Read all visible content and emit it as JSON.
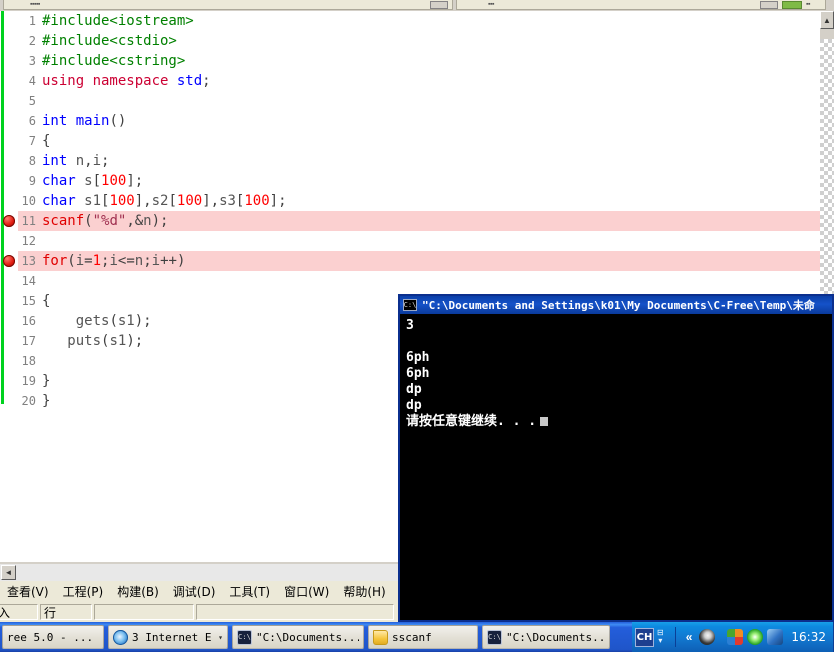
{
  "ide": {
    "menu": [
      {
        "label": "查看(V)"
      },
      {
        "label": "工程(P)"
      },
      {
        "label": "构建(B)"
      },
      {
        "label": "调试(D)"
      },
      {
        "label": "工具(T)"
      },
      {
        "label": "窗口(W)"
      },
      {
        "label": "帮助(H)"
      }
    ],
    "status": {
      "insert_mode": "插入",
      "line_label": "行",
      "cell3": "",
      "cell4": ""
    },
    "scroll": {
      "left_arrow": "◄",
      "up_arrow": "▲"
    }
  },
  "code": {
    "breakpoint_lines": [
      11,
      13
    ],
    "highlighted_lines": [
      11,
      13
    ],
    "lines": [
      {
        "n": "1",
        "tokens": [
          {
            "t": "#include<iostream>",
            "c": "pp"
          }
        ]
      },
      {
        "n": "2",
        "tokens": [
          {
            "t": "#include<cstdio>",
            "c": "pp"
          }
        ]
      },
      {
        "n": "3",
        "tokens": [
          {
            "t": "#include<cstring>",
            "c": "pp"
          }
        ]
      },
      {
        "n": "4",
        "tokens": [
          {
            "t": "using namespace ",
            "c": "kr"
          },
          {
            "t": "std",
            "c": "k"
          },
          {
            "t": ";",
            "c": "pn"
          }
        ]
      },
      {
        "n": "5",
        "tokens": []
      },
      {
        "n": "6",
        "tokens": [
          {
            "t": "int",
            "c": "k"
          },
          {
            "t": " ",
            "c": "pn"
          },
          {
            "t": "main",
            "c": "k"
          },
          {
            "t": "()",
            "c": "pn"
          }
        ]
      },
      {
        "n": "7",
        "tokens": [
          {
            "t": "{",
            "c": "pn"
          }
        ]
      },
      {
        "n": "8",
        "tokens": [
          {
            "t": "int",
            "c": "k"
          },
          {
            "t": " ",
            "c": "pn"
          },
          {
            "t": "n",
            "c": "id"
          },
          {
            "t": ",",
            "c": "pn"
          },
          {
            "t": "i",
            "c": "id"
          },
          {
            "t": ";",
            "c": "pn"
          }
        ]
      },
      {
        "n": "9",
        "tokens": [
          {
            "t": "char",
            "c": "k"
          },
          {
            "t": " ",
            "c": "pn"
          },
          {
            "t": "s",
            "c": "id"
          },
          {
            "t": "[",
            "c": "pn"
          },
          {
            "t": "100",
            "c": "num"
          },
          {
            "t": "];",
            "c": "pn"
          }
        ]
      },
      {
        "n": "10",
        "tokens": [
          {
            "t": "char",
            "c": "k"
          },
          {
            "t": " ",
            "c": "pn"
          },
          {
            "t": "s1",
            "c": "id"
          },
          {
            "t": "[",
            "c": "pn"
          },
          {
            "t": "100",
            "c": "num"
          },
          {
            "t": "],",
            "c": "pn"
          },
          {
            "t": "s2",
            "c": "id"
          },
          {
            "t": "[",
            "c": "pn"
          },
          {
            "t": "100",
            "c": "num"
          },
          {
            "t": "],",
            "c": "pn"
          },
          {
            "t": "s3",
            "c": "id"
          },
          {
            "t": "[",
            "c": "pn"
          },
          {
            "t": "100",
            "c": "num"
          },
          {
            "t": "];",
            "c": "pn"
          }
        ]
      },
      {
        "n": "11",
        "tokens": [
          {
            "t": "scanf",
            "c": "fn"
          },
          {
            "t": "(",
            "c": "pn"
          },
          {
            "t": "\"%d\"",
            "c": "str"
          },
          {
            "t": ",&",
            "c": "pn"
          },
          {
            "t": "n",
            "c": "id"
          },
          {
            "t": ");",
            "c": "pn"
          }
        ]
      },
      {
        "n": "12",
        "tokens": []
      },
      {
        "n": "13",
        "tokens": [
          {
            "t": "for",
            "c": "fn"
          },
          {
            "t": "(",
            "c": "pn"
          },
          {
            "t": "i",
            "c": "id"
          },
          {
            "t": "=",
            "c": "pn"
          },
          {
            "t": "1",
            "c": "num"
          },
          {
            "t": ";",
            "c": "pn"
          },
          {
            "t": "i",
            "c": "id"
          },
          {
            "t": "<=",
            "c": "pn"
          },
          {
            "t": "n",
            "c": "id"
          },
          {
            "t": ";",
            "c": "pn"
          },
          {
            "t": "i",
            "c": "id"
          },
          {
            "t": "++)",
            "c": "pn"
          }
        ]
      },
      {
        "n": "14",
        "tokens": []
      },
      {
        "n": "15",
        "tokens": [
          {
            "t": "{",
            "c": "pn"
          }
        ]
      },
      {
        "n": "16",
        "tokens": [
          {
            "t": "    gets",
            "c": "id"
          },
          {
            "t": "(",
            "c": "pn"
          },
          {
            "t": "s1",
            "c": "id"
          },
          {
            "t": ");",
            "c": "pn"
          }
        ]
      },
      {
        "n": "17",
        "tokens": [
          {
            "t": "   puts",
            "c": "id"
          },
          {
            "t": "(",
            "c": "pn"
          },
          {
            "t": "s1",
            "c": "id"
          },
          {
            "t": ");",
            "c": "pn"
          }
        ]
      },
      {
        "n": "18",
        "tokens": []
      },
      {
        "n": "19",
        "tokens": [
          {
            "t": "}",
            "c": "pn"
          }
        ]
      },
      {
        "n": "20",
        "tokens": [
          {
            "t": "}",
            "c": "pn"
          }
        ]
      }
    ]
  },
  "console": {
    "icon": "cmd-icon",
    "title": "\"C:\\Documents and Settings\\k01\\My Documents\\C-Free\\Temp\\未命",
    "output": "3\n\n6ph\n6ph\ndp\ndp\n请按任意键继续. . ."
  },
  "taskbar": {
    "buttons": [
      {
        "name": "taskbar-item-cfree",
        "icon": "",
        "label": "ree 5.0 - ...",
        "caret": ""
      },
      {
        "name": "taskbar-item-internet-explorer",
        "icon": "ie-icon",
        "label": "3 Internet E...",
        "caret": "▾"
      },
      {
        "name": "taskbar-item-console-1",
        "icon": "cmd-icon",
        "label": "\"C:\\Documents...",
        "caret": ""
      },
      {
        "name": "taskbar-item-sscanf",
        "icon": "folder-icon",
        "label": "sscanf",
        "caret": ""
      },
      {
        "name": "taskbar-item-console-2",
        "icon": "cmd-icon",
        "label": "\"C:\\Documents...",
        "caret": ""
      }
    ],
    "ime": {
      "label": "CH",
      "glyph": "⊟",
      "caret": "▾"
    },
    "tray": {
      "chevron": "«",
      "icons": [
        "person-icon",
        "pinwheel-icon",
        "green-shield-icon",
        "blue-network-icon"
      ],
      "clock": "16:32"
    }
  },
  "colors": {
    "highlight_row": "#fbd0d0",
    "breakpoint": "#e01b10",
    "modified_bar": "#00d21e",
    "titlebar_blue": "#0a3fa8",
    "taskbar_blue": "#245edb"
  }
}
